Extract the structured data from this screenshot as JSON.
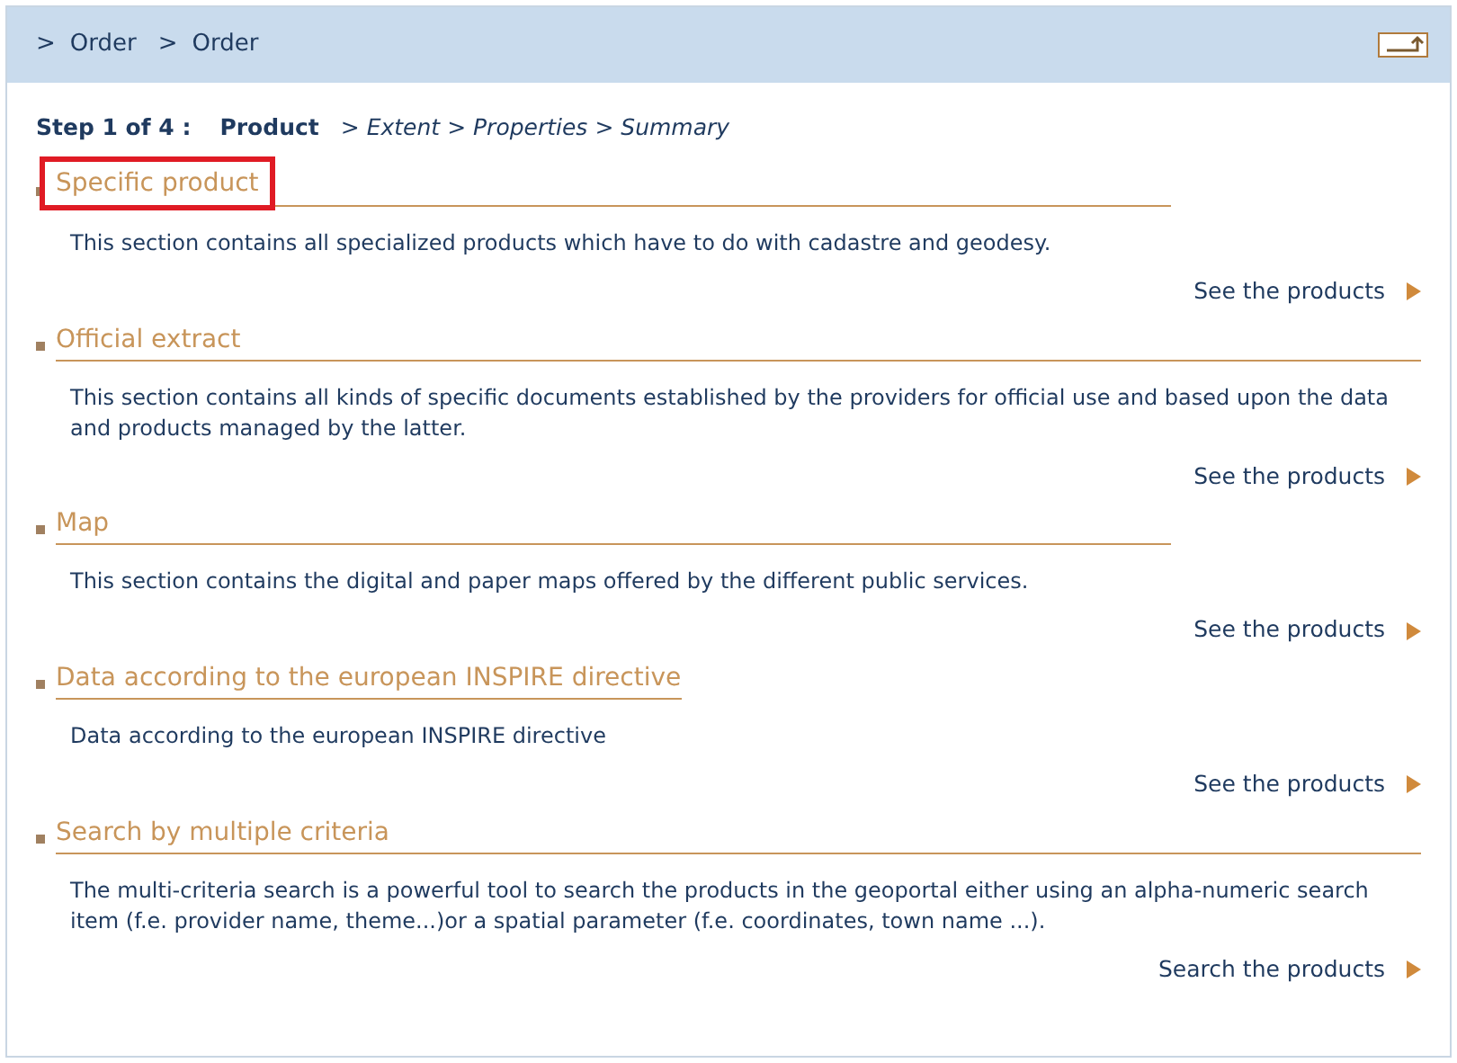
{
  "breadcrumb": [
    {
      "separator": ">",
      "label": "Order"
    },
    {
      "separator": ">",
      "label": "Order"
    }
  ],
  "steps": {
    "prefix": "Step 1 of 4 :",
    "items": [
      {
        "label": "Product",
        "selected": true
      },
      {
        "label": "Extent",
        "selected": false,
        "separator": ">"
      },
      {
        "label": "Properties",
        "selected": false,
        "separator": ">"
      },
      {
        "label": "Summary",
        "selected": false,
        "separator": ">"
      }
    ]
  },
  "sections": [
    {
      "title": "Specific product",
      "highlighted": true,
      "kind": "narrow",
      "description": "This section contains all specialized products which have to do with cadastre and geodesy.",
      "link": "See the products"
    },
    {
      "title": "Official extract",
      "highlighted": false,
      "kind": "wide",
      "description": "This section contains all kinds of specific documents established by the providers for official use and based upon the data and products managed by the latter.",
      "link": "See the products"
    },
    {
      "title": "Map",
      "highlighted": false,
      "kind": "narrow",
      "description": "This section contains the digital and paper maps offered by the different public services.",
      "link": "See the products"
    },
    {
      "title": "Data according to the european INSPIRE directive",
      "highlighted": false,
      "kind": "fit",
      "description": "Data according to the european INSPIRE directive",
      "link": "See the products"
    },
    {
      "title": "Search by multiple criteria",
      "highlighted": false,
      "kind": "wide",
      "description": "The multi-criteria search is a powerful tool to search the products in the geoportal either using an alpha-numeric search item (f.e. provider name, theme...)or a spatial parameter (f.e. coordinates, town name ...).",
      "link": "Search the products"
    }
  ]
}
